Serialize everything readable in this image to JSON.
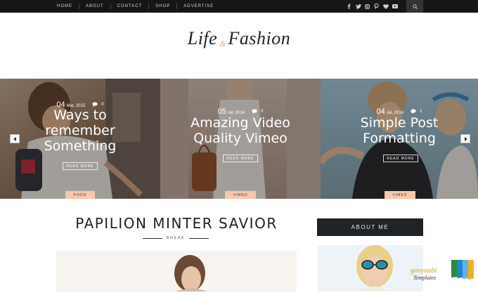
{
  "topbar": {
    "nav": [
      "HOME",
      "ABOUT",
      "CONTACT",
      "SHOP",
      "ADVERTISE"
    ],
    "social_icons": [
      "facebook-icon",
      "twitter-icon",
      "instagram-icon",
      "pinterest-icon",
      "heart-icon",
      "youtube-icon"
    ],
    "search_icon": "search-icon"
  },
  "logo": {
    "left": "Life",
    "amp": "&",
    "right": "Fashion"
  },
  "slides": [
    {
      "day": "04",
      "date_rest": "Mar, 2015",
      "comments": "0",
      "title_lines": [
        "Ways to",
        "remember",
        "Something"
      ],
      "read_more": "READ MORE",
      "category": "FOOD"
    },
    {
      "day": "05",
      "date_rest": "Jul, 2014",
      "comments": "0",
      "title_lines": [
        "Amazing Video",
        "Quality Vimeo"
      ],
      "read_more": "READ MORE",
      "category": "VIMEO"
    },
    {
      "day": "04",
      "date_rest": "Jul, 2014",
      "comments": "1",
      "title_lines": [
        "Simple Post",
        "Formatting"
      ],
      "read_more": "READ MORE",
      "category": "VIMEO"
    }
  ],
  "slider_controls": {
    "prev": "prev-arrow-icon",
    "next": "next-arrow-icon"
  },
  "post": {
    "title": "PAPILION MINTER SAVIOR",
    "label": "BREAK"
  },
  "sidebar": {
    "about_title": "ABOUT ME"
  },
  "watermark": {
    "line1": "gooyaabi",
    "line2": "Templates"
  },
  "colors": {
    "topbar": "#161616",
    "accent": "#f6c7a8",
    "sidebar_head": "#1f2226"
  }
}
